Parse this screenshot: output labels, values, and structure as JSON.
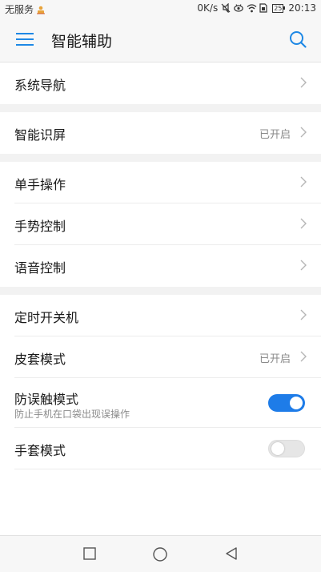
{
  "status_bar": {
    "carrier": "无服务",
    "speed": "0K/s",
    "battery": "25",
    "time": "20:13",
    "icons": [
      "warning-icon",
      "mute-icon",
      "eye-icon",
      "wifi-icon",
      "sim-icon",
      "battery-icon"
    ]
  },
  "app_bar": {
    "title": "智能辅助",
    "menu_icon": "hamburger-menu-icon",
    "search_icon": "search-icon"
  },
  "accent_color": "#1e88e5",
  "sections": [
    {
      "items": [
        {
          "label": "系统导航",
          "value": "",
          "control": "chevron"
        }
      ]
    },
    {
      "items": [
        {
          "label": "智能识屏",
          "value": "已开启",
          "control": "chevron"
        }
      ]
    },
    {
      "items": [
        {
          "label": "单手操作",
          "value": "",
          "control": "chevron"
        },
        {
          "label": "手势控制",
          "value": "",
          "control": "chevron"
        },
        {
          "label": "语音控制",
          "value": "",
          "control": "chevron"
        }
      ]
    },
    {
      "items": [
        {
          "label": "定时开关机",
          "value": "",
          "control": "chevron"
        },
        {
          "label": "皮套模式",
          "value": "已开启",
          "control": "chevron"
        },
        {
          "label": "防误触模式",
          "subtitle": "防止手机在口袋出现误操作",
          "control": "toggle",
          "on": true
        },
        {
          "label": "手套模式",
          "control": "toggle",
          "on": false
        }
      ]
    }
  ],
  "nav_bar": {
    "buttons": [
      "recent-apps-icon",
      "home-icon",
      "back-icon"
    ]
  }
}
